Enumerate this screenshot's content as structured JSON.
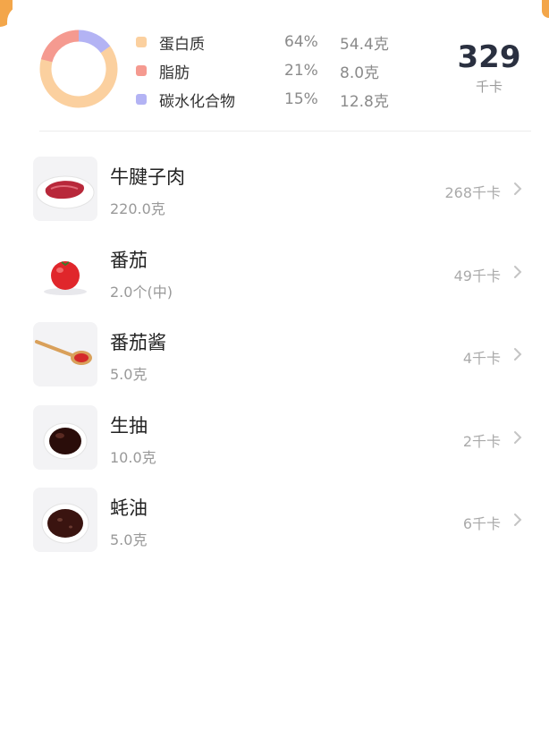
{
  "summary": {
    "macros": [
      {
        "name": "蛋白质",
        "percent": "64%",
        "amount": "54.4克",
        "color": "#fbd09f",
        "ratio": 0.64
      },
      {
        "name": "脂肪",
        "percent": "21%",
        "amount": "8.0克",
        "color": "#f59a90",
        "ratio": 0.21
      },
      {
        "name": "碳水化合物",
        "percent": "15%",
        "amount": "12.8克",
        "color": "#b3b3f4",
        "ratio": 0.15
      }
    ],
    "total_calories": "329",
    "calorie_unit": "千卡"
  },
  "foods": [
    {
      "name": "牛腱子肉",
      "amount": "220.0克",
      "calories": "268千卡",
      "icon": "beef-icon"
    },
    {
      "name": "番茄",
      "amount": "2.0个(中)",
      "calories": "49千卡",
      "icon": "tomato-icon"
    },
    {
      "name": "番茄酱",
      "amount": "5.0克",
      "calories": "4千卡",
      "icon": "ketchup-spoon-icon"
    },
    {
      "name": "生抽",
      "amount": "10.0克",
      "calories": "2千卡",
      "icon": "soy-sauce-icon"
    },
    {
      "name": "蚝油",
      "amount": "5.0克",
      "calories": "6千卡",
      "icon": "oyster-sauce-icon"
    }
  ]
}
